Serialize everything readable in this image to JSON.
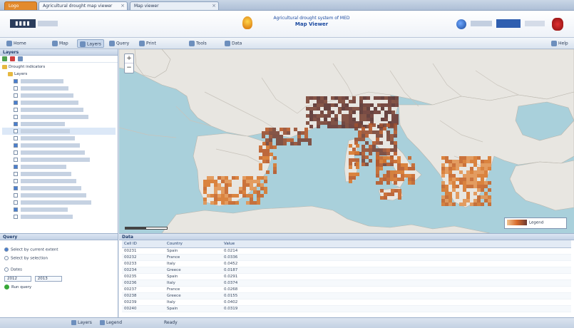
{
  "browser_tabs": [
    {
      "label": "Logo",
      "active": false
    },
    {
      "label": "Agricultural drought map viewer",
      "active": true
    },
    {
      "label": "Map viewer",
      "active": false
    }
  ],
  "header": {
    "title_line1": "Agricultural drought system of MED",
    "title_line2": "Map Viewer"
  },
  "toolbar": {
    "items": [
      "Home",
      "Map",
      "Layers",
      "Query",
      "Print",
      "Tools",
      "Data",
      "Help"
    ]
  },
  "left_panel": {
    "title": "Layers",
    "tree": {
      "root": "Drought indicators",
      "group": "Layers",
      "layers_count": 20
    }
  },
  "map": {
    "legend_label": "Legend",
    "zoom_in": "+",
    "zoom_out": "−"
  },
  "query_panel": {
    "title": "Query",
    "option1": "Select by current extent",
    "option2": "Select by selection",
    "option3": "Dates",
    "date_from": "2012",
    "date_to": "2013",
    "run_label": "Run query"
  },
  "data_panel": {
    "title": "Data",
    "columns": [
      "Cell ID",
      "Country",
      "Value"
    ],
    "rows": [
      [
        "00231",
        "Spain",
        "0.0214"
      ],
      [
        "00232",
        "France",
        "0.0336"
      ],
      [
        "00233",
        "Italy",
        "0.0452"
      ],
      [
        "00234",
        "Greece",
        "0.0187"
      ],
      [
        "00235",
        "Spain",
        "0.0291"
      ],
      [
        "00236",
        "Italy",
        "0.0374"
      ],
      [
        "00237",
        "France",
        "0.0268"
      ],
      [
        "00238",
        "Greece",
        "0.0155"
      ],
      [
        "00239",
        "Italy",
        "0.0402"
      ],
      [
        "00240",
        "Spain",
        "0.0319"
      ]
    ]
  },
  "statusbar": {
    "items": [
      "Layers",
      "Legend",
      "Ready"
    ]
  }
}
